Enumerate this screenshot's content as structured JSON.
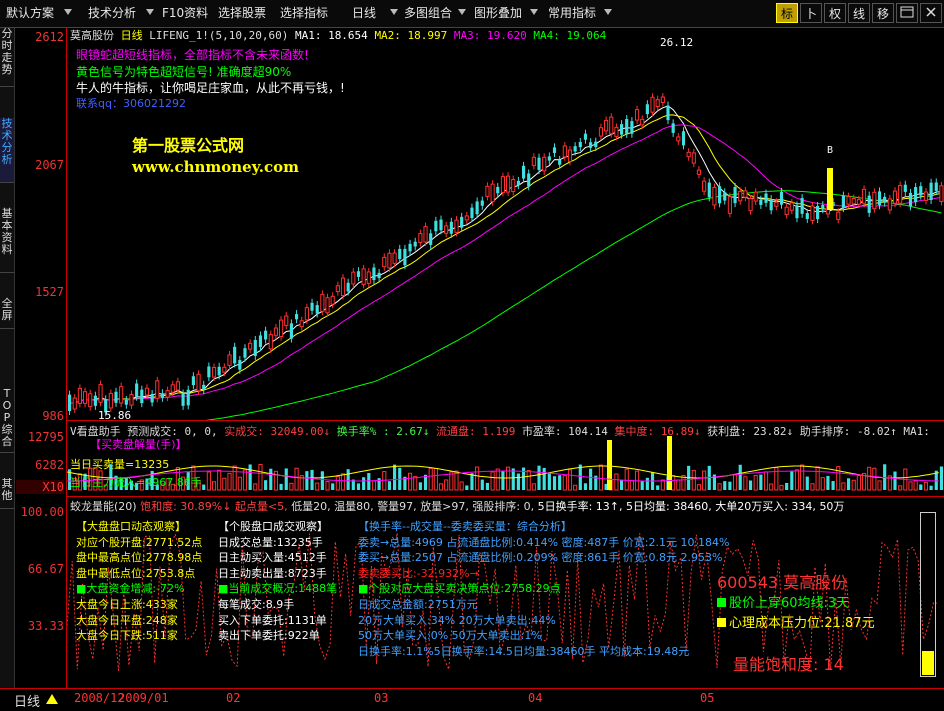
{
  "toolbar": {
    "items": [
      "默认方案",
      "技术分析",
      "F10资料",
      "选择股票",
      "选择指标",
      "日线",
      "多图组合",
      "图形叠加",
      "常用指标"
    ],
    "right_buttons": [
      "标",
      "卜",
      "权",
      "线",
      "移"
    ],
    "icons": [
      "panel-icon",
      "close-icon"
    ]
  },
  "sidebar": {
    "tabs": [
      "分时走势",
      "技术分析",
      "基本资料",
      "全屏",
      "TOP综合",
      "其他"
    ]
  },
  "main_chart": {
    "stock_name": "莫高股份",
    "period": "日线",
    "indicator": "LIFENG_1!(5,10,20,60)",
    "ma1": "MA1: 18.654",
    "ma2": "MA2: 18.997",
    "ma3": "MA3: 19.620",
    "ma4": "MA4: 19.064",
    "ma_colors": {
      "ma1": "#ffffff",
      "ma2": "#ffff00",
      "ma3": "#ff00ff",
      "ma4": "#00ff00"
    },
    "y_labels": [
      "2612",
      "2067",
      "1527",
      "986"
    ],
    "notes": [
      "眼镜蛇超短线指标，全部指标不含未来函数!",
      "黄色信号为特色超短信号! 准确度超90%",
      "牛人的牛指标，让你喝足庄家血，从此不再亏钱，!"
    ],
    "contact": "联系qq：306021292",
    "watermark_cn": "第一股票公式网",
    "watermark_en": "www.chnmoney.com",
    "high_marker": "26.12",
    "low_marker": "15.86",
    "b_marker": "B"
  },
  "volume_panel": {
    "header": [
      {
        "text": "V看盘助手  预测成交: 0, 0,",
        "color": "#dddddd"
      },
      {
        "text": "实成交: 32049.00↓",
        "color": "#ff4040"
      },
      {
        "text": "换手率% : 2.67↓",
        "color": "#40ff40"
      },
      {
        "text": "流通盘: 1.199",
        "color": "#ff4040"
      },
      {
        "text": "市盈率: 104.14",
        "color": "#dddddd"
      },
      {
        "text": "集中度: 16.89↓",
        "color": "#ff4040"
      },
      {
        "text": "获利盘: 23.82↓",
        "color": "#dddddd"
      },
      {
        "text": "助手排序: -8.02↑",
        "color": "#dddddd"
      },
      {
        "text": "MA1:",
        "color": "#dddddd"
      }
    ],
    "y_labels": [
      "12795",
      "6282",
      "X10"
    ],
    "buy_sell_label": "【买卖盘解量(手)】",
    "today_buy": "当日买卖量=13235",
    "today_flow": "当日主力流入=4967.86手"
  },
  "dragon_panel": {
    "title": "蛟龙量能(20)",
    "header": [
      {
        "text": "饱和度: 30.89%↓",
        "color": "#ff4040"
      },
      {
        "text": "起点量<5,",
        "color": "#ff4040"
      },
      {
        "text": "低量20,",
        "color": "#dddddd"
      },
      {
        "text": "温量80,",
        "color": "#dddddd"
      },
      {
        "text": "警量97,",
        "color": "#dddddd"
      },
      {
        "text": "放量>97,",
        "color": "#dddddd"
      },
      {
        "text": "强股排序: 0,",
        "color": "#dddddd"
      },
      {
        "text": "5日换手率: 13↑,",
        "color": "#ffffff"
      },
      {
        "text": "5日均量: 38460,",
        "color": "#ffffff"
      },
      {
        "text": "大单20万买入: 334,",
        "color": "#ffffff"
      },
      {
        "text": "50万",
        "color": "#ffffff"
      }
    ],
    "y_labels": [
      "100.00",
      "66.67",
      "33.33"
    ],
    "col1": [
      {
        "text": "【大盘盘口动态观察】",
        "color": "#ffff00"
      },
      {
        "text": "对应个股开盘:2771.52点",
        "color": "#ffff00"
      },
      {
        "text": "盘中最高点位:2778.98点",
        "color": "#ffff00"
      },
      {
        "text": "盘中最低点位:2753.8点",
        "color": "#ffff00"
      },
      {
        "text": "■大盘资金增减:-72%",
        "color": "#00ff00"
      },
      {
        "text": "大盘今日上涨:433家",
        "color": "#ffff00"
      },
      {
        "text": "大盘今日平盘:248家",
        "color": "#ffff00"
      },
      {
        "text": "大盘今日下跌:511家",
        "color": "#ffff00"
      }
    ],
    "col2": [
      {
        "text": "【个股盘口成交观察】",
        "color": "#ffffff"
      },
      {
        "text": "日成交总量:13235手",
        "color": "#ffffff"
      },
      {
        "text": "日主动买入量:4512手",
        "color": "#ffffff"
      },
      {
        "text": "日主动卖出量:8723手",
        "color": "#ffffff"
      },
      {
        "text": "■当前成交概况:1488笔",
        "color": "#00ff00"
      },
      {
        "text": "每笔成交:8.9手",
        "color": "#ffffff"
      },
      {
        "text": "买入下单委托:1131单",
        "color": "#ffffff"
      },
      {
        "text": "卖出下单委托:922单",
        "color": "#ffffff"
      }
    ],
    "col3": [
      {
        "text": "【换手率--成交量--委卖委买量：综合分析】",
        "color": "#40a0ff"
      },
      {
        "text": "委卖→总量:4969 占流通盘比例:0.414% 密度:487手  价宽:2.1元 10.184%",
        "color": "#40a0ff"
      },
      {
        "text": "委买→总量:2507 占流通盘比例:0.209% 密度:861手  价宽:0.8元  2.953%",
        "color": "#40a0ff"
      },
      {
        "text": "委卖委买比:-32.932%→",
        "color": "#ff2020"
      },
      {
        "text": "■个股对应大盘买卖决策点位:2758.29点",
        "color": "#00ff00"
      },
      {
        "text": "日成交总金额:2751万元",
        "color": "#40a0ff"
      },
      {
        "text": "20万大单买入:34%  20万大单卖出:44%",
        "color": "#40a0ff"
      },
      {
        "text": "50万大单买入:0%   50万大单卖出:1%",
        "color": "#40a0ff"
      },
      {
        "text": "日换手率:1.1%5日换手率:14.5日均量:38460手   平均成本:19.48元",
        "color": "#40a0ff"
      }
    ],
    "stock_code": "600543  莫高股份",
    "ma60": "股价上穿60均线:3天",
    "pressure": "心理成本压力位:21.87元",
    "saturation": "量能饱和度: 14"
  },
  "bottom": {
    "period": "日线",
    "dates": [
      "2008/12",
      "2009/01",
      "02",
      "03",
      "04",
      "05"
    ]
  }
}
